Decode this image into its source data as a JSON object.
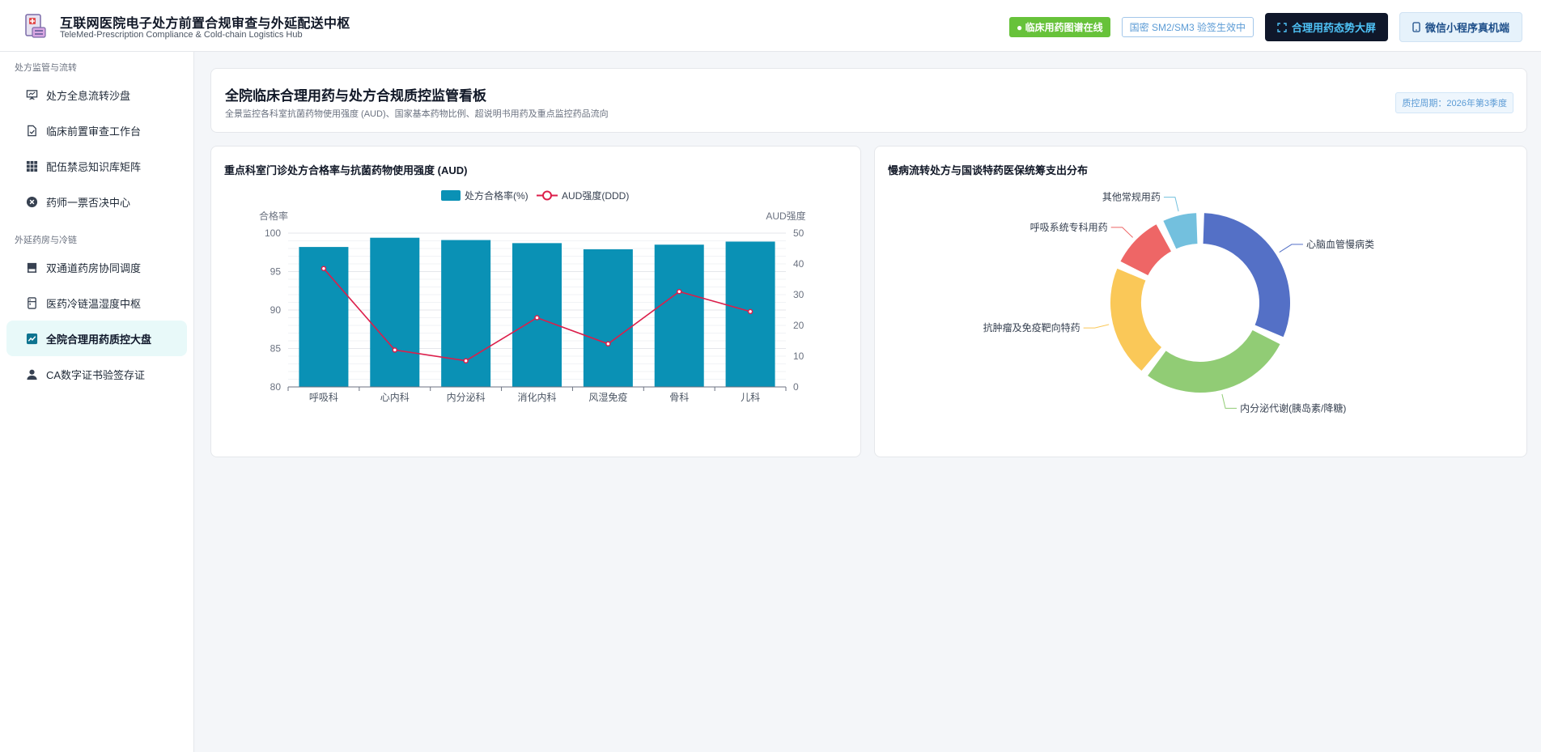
{
  "header": {
    "title": "互联网医院电子处方前置合规审查与外延配送中枢",
    "subtitle": "TeleMed-Prescription Compliance & Cold-chain Logistics Hub",
    "badge_online": "● 临床用药图谱在线",
    "badge_sm": "国密 SM2/SM3 验签生效中",
    "btn_dashboard": "合理用药态势大屏",
    "btn_miniapp": "微信小程序真机端"
  },
  "sidebar": {
    "group1": "处方监管与流转",
    "group2": "外延药房与冷链",
    "items": [
      {
        "label": "处方全息流转沙盘",
        "icon": "presentation-icon"
      },
      {
        "label": "临床前置审查工作台",
        "icon": "file-check-icon"
      },
      {
        "label": "配伍禁忌知识库矩阵",
        "icon": "grid-icon"
      },
      {
        "label": "药师一票否决中心",
        "icon": "close-circle-icon"
      },
      {
        "label": "双通道药房协同调度",
        "icon": "store-icon"
      },
      {
        "label": "医药冷链温湿度中枢",
        "icon": "fridge-icon"
      },
      {
        "label": "全院合理用药质控大盘",
        "icon": "chart-line-icon",
        "active": true
      },
      {
        "label": "CA数字证书验签存证",
        "icon": "user-icon"
      }
    ]
  },
  "hero": {
    "title": "全院临床合理用药与处方合规质控监管看板",
    "subtitle": "全景监控各科室抗菌药物使用强度 (AUD)、国家基本药物比例、超说明书用药及重点监控药品流向",
    "tag": "质控周期：2026年第3季度"
  },
  "bar_card": {
    "title": "重点科室门诊处方合格率与抗菌药物使用强度 (AUD)"
  },
  "pie_card": {
    "title": "慢病流转处方与国谈特药医保统筹支出分布"
  },
  "chart_data": [
    {
      "type": "bar",
      "categories": [
        "呼吸科",
        "心内科",
        "内分泌科",
        "消化内科",
        "风湿免疫",
        "骨科",
        "儿科"
      ],
      "series": [
        {
          "name": "处方合格率(%)",
          "type": "bar",
          "axis": "left",
          "values": [
            98.2,
            99.4,
            99.1,
            98.7,
            97.9,
            98.5,
            98.9
          ],
          "color": "#0a91b5"
        },
        {
          "name": "AUD强度(DDD)",
          "type": "line",
          "axis": "right",
          "values": [
            38.5,
            12.0,
            8.5,
            22.5,
            14.0,
            31.0,
            24.5
          ],
          "color": "#dc1e4a"
        }
      ],
      "ylabel_left": "合格率",
      "ylabel_right": "AUD强度",
      "ylim_left": [
        80,
        100
      ],
      "yticks_left": [
        80,
        85,
        90,
        95,
        100
      ],
      "ylim_right": [
        0,
        50
      ],
      "yticks_right": [
        0,
        10,
        20,
        30,
        40,
        50
      ],
      "legend": "top-center",
      "grid": true
    },
    {
      "type": "pie",
      "donut": true,
      "labels": [
        "心脑血管慢病类",
        "内分泌代谢(胰岛素/降糖)",
        "抗肿瘤及免疫靶向特药",
        "呼吸系统专科用药",
        "其他常规用药"
      ],
      "values": [
        30,
        27,
        20,
        10,
        7
      ],
      "colors": [
        "#5470c6",
        "#91cc75",
        "#fac858",
        "#ee6666",
        "#73c0de"
      ]
    }
  ]
}
